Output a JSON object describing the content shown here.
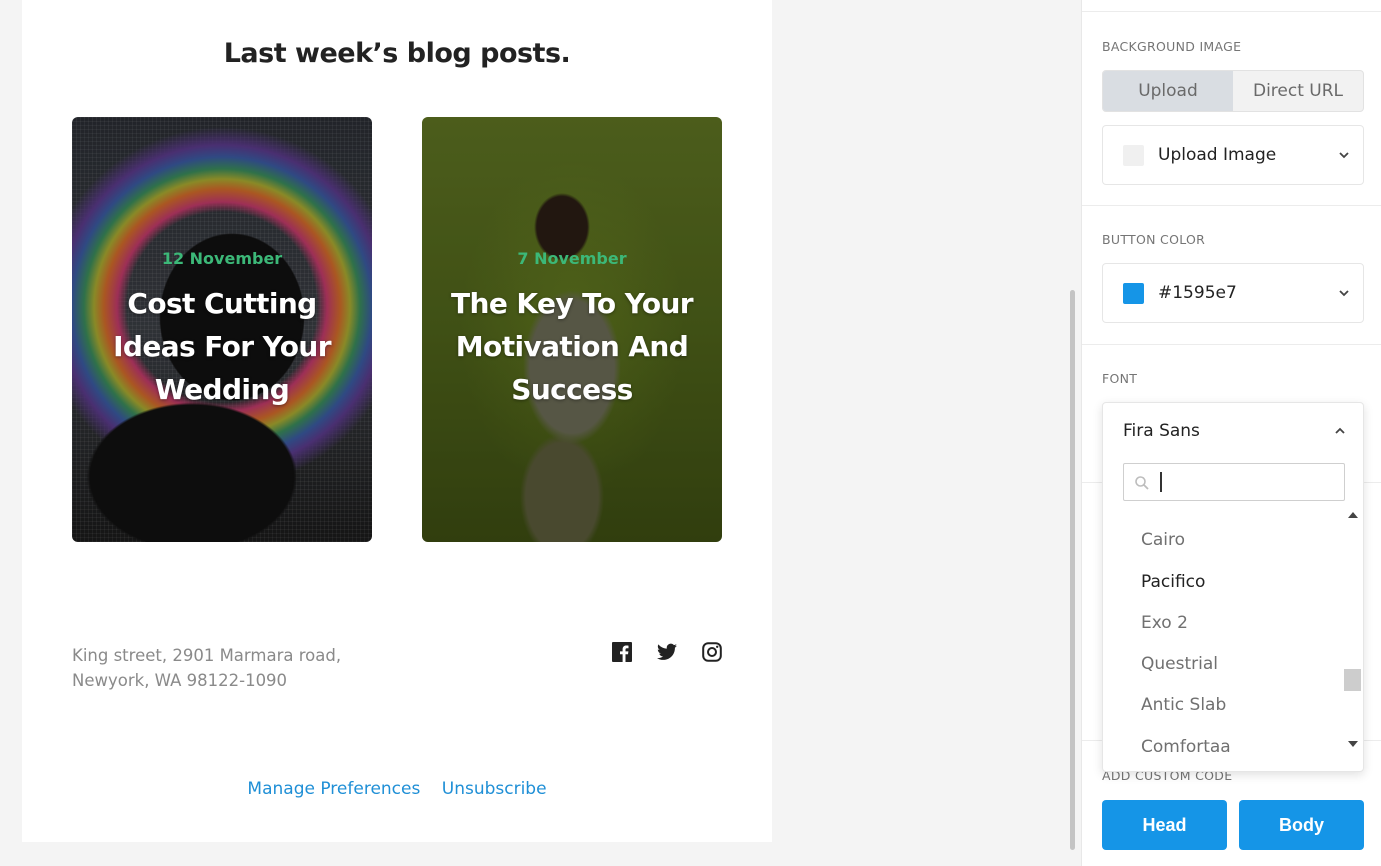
{
  "email": {
    "title": "Last week’s blog posts.",
    "posts": [
      {
        "date": "12 November",
        "title": "Cost Cutting Ideas For Your Wedding"
      },
      {
        "date": "7 November",
        "title": "The Key To Your Motivation And Success"
      }
    ],
    "address_line1": "King street, 2901 Marmara road,",
    "address_line2": "Newyork, WA 98122-1090",
    "social_icons": [
      "facebook-icon",
      "twitter-icon",
      "instagram-icon"
    ],
    "links": {
      "manage": "Manage Preferences",
      "unsubscribe": "Unsubscribe"
    },
    "accent_date_color": "#3cb878",
    "link_color": "#1f8fd6"
  },
  "panel": {
    "background_image": {
      "label": "BACKGROUND IMAGE",
      "tabs": [
        "Upload",
        "Direct URL"
      ],
      "active_tab": "Upload",
      "dropdown_label": "Upload Image"
    },
    "button_color": {
      "label": "BUTTON COLOR",
      "value": "#1595e7"
    },
    "font": {
      "label": "FONT",
      "selected": "Fira Sans",
      "search_value": "",
      "options": [
        "Cairo",
        "Pacifico",
        "Exo 2",
        "Questrial",
        "Antic Slab",
        "Comfortaa"
      ],
      "hovered": "Pacifico"
    },
    "custom_code": {
      "label": "ADD CUSTOM CODE",
      "head_label": "Head",
      "body_label": "Body"
    }
  }
}
